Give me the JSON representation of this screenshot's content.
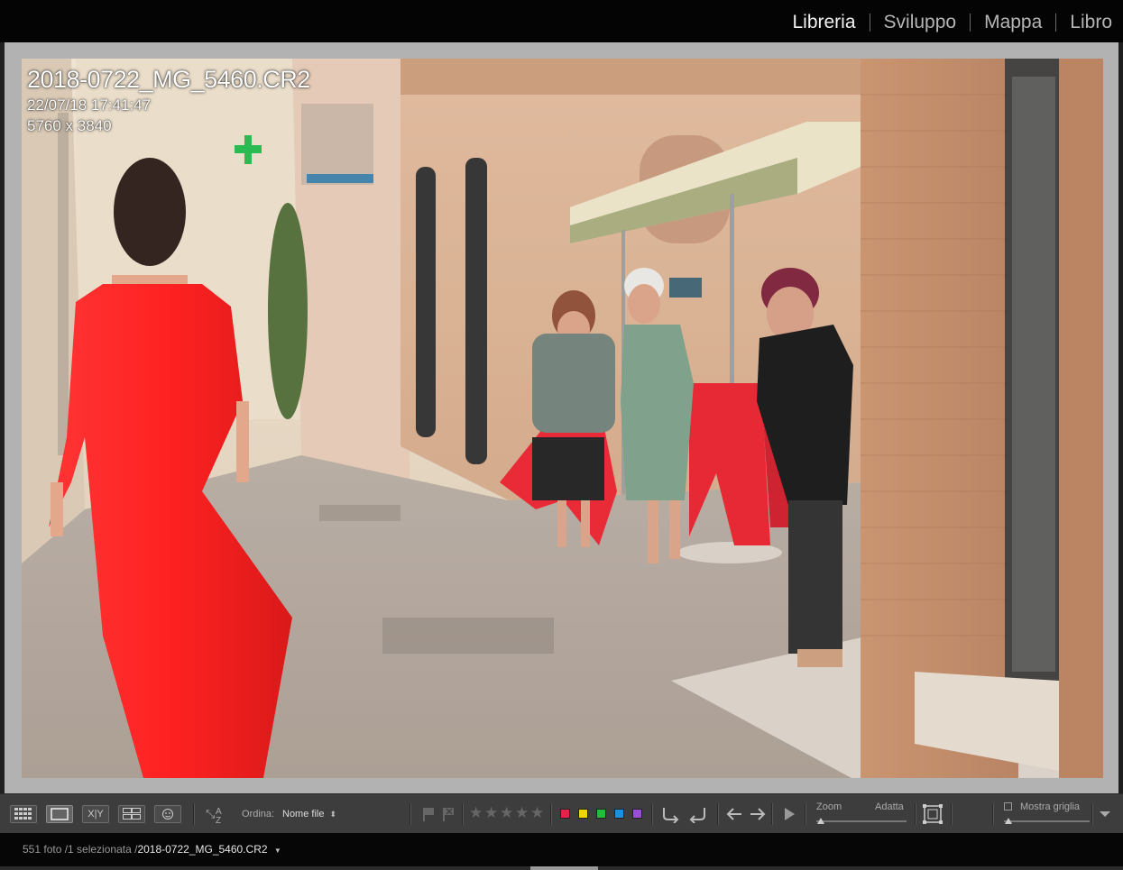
{
  "app": {
    "modules": [
      {
        "label": "Libreria",
        "active": true
      },
      {
        "label": "Sviluppo",
        "active": false
      },
      {
        "label": "Mappa",
        "active": false
      },
      {
        "label": "Libro",
        "active": false
      }
    ]
  },
  "photo_info": {
    "filename": "2018-0722_MG_5460.CR2",
    "datetime": "22/07/18 17:41:47",
    "dimensions": "5760 x 3840"
  },
  "toolbar": {
    "view_buttons": [
      "grid-view-icon",
      "loupe-view-icon",
      "compare-view-icon",
      "survey-view-icon",
      "people-view-icon"
    ],
    "compare_text": "X|Y",
    "sort_label": "Ordina:",
    "sort_value": "Nome file",
    "rating": 0,
    "color_labels": [
      "#e8204a",
      "#f0d400",
      "#1fbf3a",
      "#1e8fe0",
      "#9a4ed6"
    ],
    "zoom_label": "Zoom",
    "zoom_value": "Adatta",
    "zoom_level": 0.0,
    "grid_label": "Mostra griglia",
    "grid_checked": false
  },
  "status": {
    "count_text": "551 foto /1 selezionata /",
    "selected_file": "2018-0722_MG_5460.CR2"
  }
}
